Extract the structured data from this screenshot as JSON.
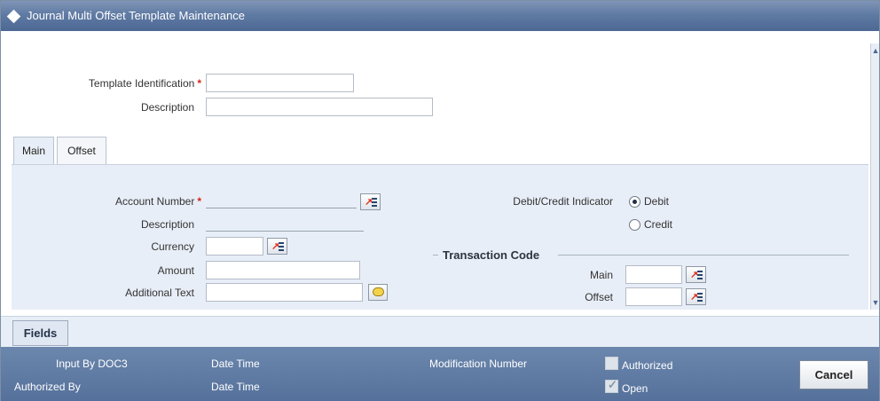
{
  "window": {
    "title": "Journal Multi Offset Template Maintenance"
  },
  "header": {
    "template_identification_label": "Template Identification",
    "template_identification_value": "",
    "description_label": "Description",
    "description_value": "",
    "required_mark": "*"
  },
  "tabs": [
    {
      "label": "Main"
    },
    {
      "label": "Offset"
    }
  ],
  "main": {
    "account_number_label": "Account Number",
    "account_description_label": "Description",
    "currency_label": "Currency",
    "amount_label": "Amount",
    "additional_text_label": "Additional Text",
    "debit_credit_label": "Debit/Credit Indicator",
    "debit_label": "Debit",
    "credit_label": "Credit",
    "selected_indicator": "Debit",
    "transaction_code_title": "Transaction Code",
    "tc_main_label": "Main",
    "tc_offset_label": "Offset"
  },
  "fields_button": "Fields",
  "footer": {
    "input_by_label": "Input By DOC3",
    "authorized_by_label": "Authorized By",
    "date_time_label_1": "Date Time",
    "date_time_label_2": "Date Time",
    "modification_number_label": "Modification Number",
    "authorized_label": "Authorized",
    "open_label": "Open",
    "authorized_checked": false,
    "open_checked": true,
    "cancel_label": "Cancel"
  },
  "colors": {
    "title_bar": "#5f7aa3",
    "footer": "#55719b",
    "panel": "#e8eef7",
    "required": "#d6261e"
  }
}
